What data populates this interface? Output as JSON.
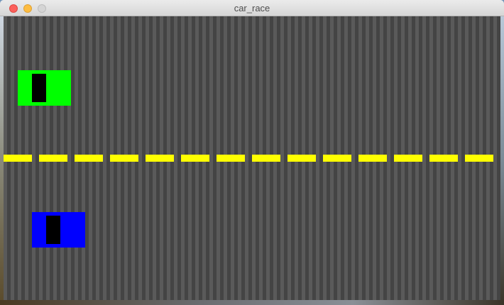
{
  "window": {
    "title": "car_race",
    "buttons": [
      "close",
      "minimize",
      "zoom"
    ]
  },
  "game": {
    "background_colors": [
      "#5a5a5a",
      "#444444"
    ],
    "lane_marking_color": "#ffff00",
    "cars": [
      {
        "name": "player-one-car",
        "color": "#00ff00",
        "lane": "top",
        "windshield_color": "#000000"
      },
      {
        "name": "player-two-car",
        "color": "#0000ff",
        "lane": "bottom",
        "windshield_color": "#000000"
      }
    ]
  }
}
